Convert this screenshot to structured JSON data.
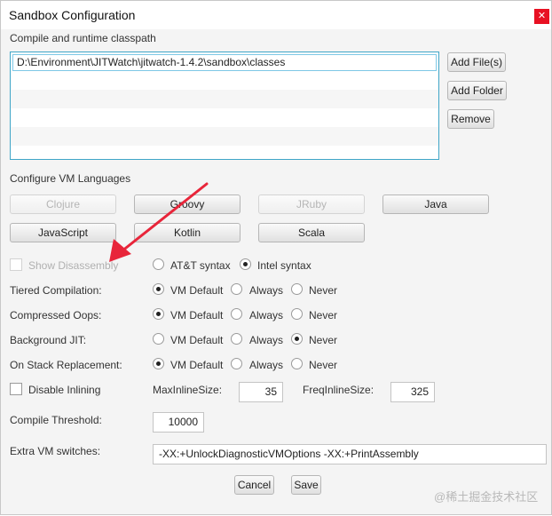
{
  "window": {
    "title": "Sandbox Configuration",
    "close": "✕"
  },
  "classpath": {
    "label": "Compile and runtime classpath",
    "entries": [
      "D:\\Environment\\JITWatch\\jitwatch-1.4.2\\sandbox\\classes"
    ],
    "buttons": {
      "add_file": "Add File(s)",
      "add_folder": "Add Folder",
      "remove": "Remove"
    }
  },
  "vm_languages": {
    "label": "Configure VM Languages",
    "buttons": [
      "Clojure",
      "Groovy",
      "JRuby",
      "Java",
      "JavaScript",
      "Kotlin",
      "Scala"
    ]
  },
  "disassembly": {
    "show_label": "Show Disassembly",
    "att": "AT&T syntax",
    "intel": "Intel syntax",
    "selected": "Intel syntax"
  },
  "options": {
    "vm_default": "VM Default",
    "always": "Always",
    "never": "Never",
    "rows": [
      {
        "label": "Tiered Compilation:",
        "selected": "VM Default"
      },
      {
        "label": "Compressed Oops:",
        "selected": "VM Default"
      },
      {
        "label": "Background JIT:",
        "selected": "Never"
      },
      {
        "label": "On Stack Replacement:",
        "selected": "VM Default"
      }
    ]
  },
  "inlining": {
    "disable_label": "Disable Inlining",
    "max_label": "MaxInlineSize:",
    "max_value": "35",
    "freq_label": "FreqInlineSize:",
    "freq_value": "325"
  },
  "threshold": {
    "label": "Compile Threshold:",
    "value": "10000"
  },
  "extra": {
    "label": "Extra VM switches:",
    "value": "-XX:+UnlockDiagnosticVMOptions -XX:+PrintAssembly"
  },
  "footer": {
    "cancel": "Cancel",
    "save": "Save"
  },
  "watermark": "@稀土掘金技术社区",
  "colors": {
    "accent": "#3fa5c7",
    "close_bg": "#e81123",
    "arrow": "#e8253a"
  }
}
